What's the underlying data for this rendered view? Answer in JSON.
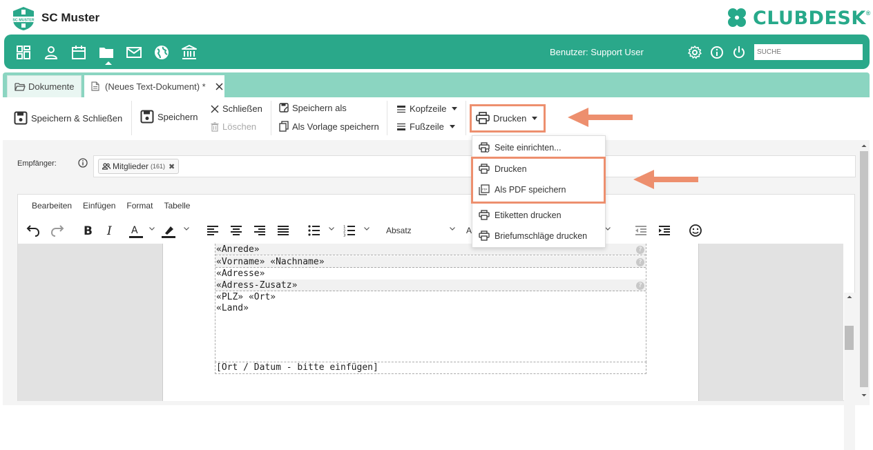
{
  "header": {
    "badge_text": "SC MUSTER",
    "club_name": "SC Muster",
    "brand": "CLUBDESK",
    "brand_reg": "®",
    "brand_color": "#27a98a"
  },
  "navbar": {
    "items": [
      "dashboard-icon",
      "person-icon",
      "calendar-icon",
      "folder-icon",
      "mail-icon",
      "globe-icon",
      "bank-icon"
    ],
    "active": "folder-icon",
    "user_label": "Benutzer: Support User",
    "search_placeholder": "SUCHE",
    "color": "#2aa88a"
  },
  "tabs": [
    {
      "label": "Dokumente",
      "icon": "folder-open-icon"
    },
    {
      "label": "(Neues Text-Dokument) *",
      "icon": "document-icon",
      "closable": true
    }
  ],
  "toolbar": {
    "save_close": "Speichern & Schließen",
    "save": "Speichern",
    "close": "Schließen",
    "delete": "Löschen",
    "save_as": "Speichern als",
    "save_template": "Als Vorlage speichern",
    "header": "Kopfzeile",
    "footer": "Fußzeile",
    "print": "Drucken"
  },
  "recipients": {
    "label": "Empfänger:",
    "chip_label": "Mitglieder",
    "chip_count": "(161)",
    "chip_remove": "✖"
  },
  "editor": {
    "menu": [
      "Bearbeiten",
      "Einfügen",
      "Format",
      "Tabelle"
    ],
    "block_format": "Absatz",
    "font_partial": "A"
  },
  "document": {
    "lines": [
      {
        "text": "«Anrede»",
        "field": true
      },
      {
        "text": "«Vorname» «Nachname»",
        "field": true
      },
      {
        "text": "«Adresse»",
        "field": false
      },
      {
        "text": "«Adress-Zusatz»",
        "field": true
      },
      {
        "text": "«PLZ» «Ort»",
        "field": false
      },
      {
        "text": "«Land»",
        "field": false
      }
    ],
    "place_date": "[Ort / Datum - bitte einfügen]",
    "help_glyph": "?"
  },
  "print_menu": {
    "items": [
      "Seite einrichten...",
      "Drucken",
      "Als PDF speichern",
      "Etiketten drucken",
      "Briefumschläge drucken"
    ]
  },
  "annotation_color": "#ed8f6e"
}
